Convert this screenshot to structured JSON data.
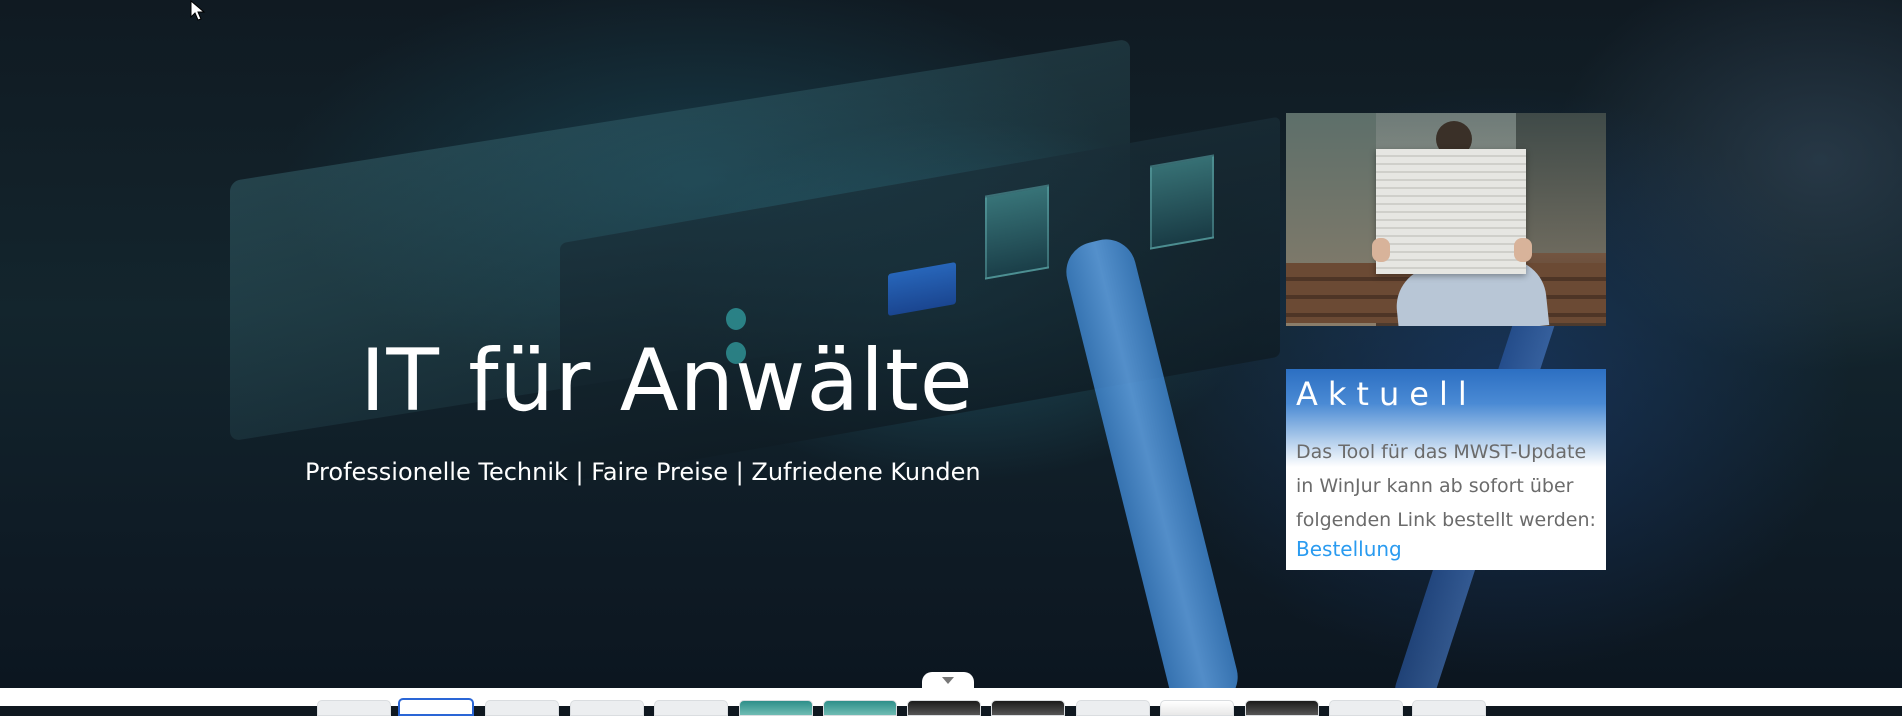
{
  "hero": {
    "title": "IT für Anwälte",
    "subtitle": "Professionelle Technik | Faire Preise | Zufriedene Kunden"
  },
  "news": {
    "heading": "Aktuell",
    "text": "Das Tool für das MWST-Update in WinJur kann ab sofort über folgenden Link bestellt werden:",
    "link_label": "Bestellung"
  },
  "colors": {
    "accent_blue": "#2c6fc2",
    "link_blue": "#2a9bf0",
    "text_gray": "#6b6b6b"
  },
  "icons": {
    "cursor": "mouse-cursor-icon",
    "strip_toggle": "chevron-down-icon"
  }
}
